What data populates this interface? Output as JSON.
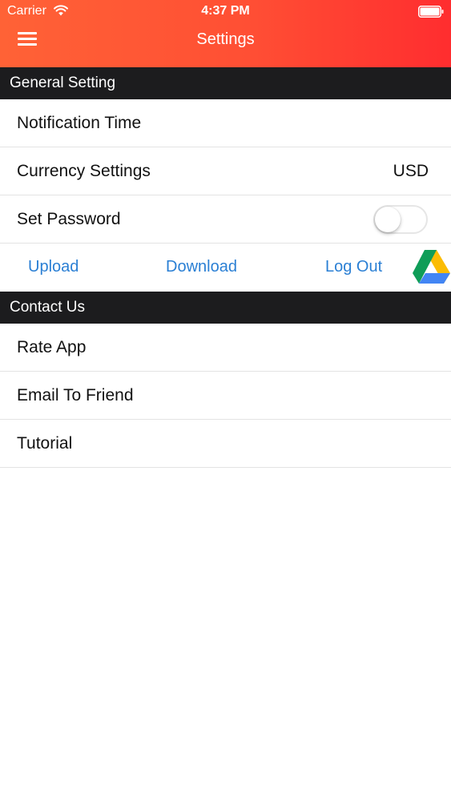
{
  "status_bar": {
    "carrier": "Carrier",
    "time": "4:37 PM",
    "wifi_icon": "wifi-icon",
    "battery_icon": "battery-full-icon"
  },
  "navbar": {
    "title": "Settings",
    "menu_icon": "hamburger-menu-icon",
    "gradient_colors": [
      "#ff6236",
      "#ff2d2f"
    ]
  },
  "general_section": {
    "header": "General Setting",
    "rows": [
      {
        "label": "Notification Time",
        "value": ""
      },
      {
        "label": "Currency Settings",
        "value": "USD"
      },
      {
        "label": "Set Password",
        "toggle_on": false
      }
    ]
  },
  "sync_actions": {
    "upload": "Upload",
    "download": "Download",
    "logout": "Log Out",
    "service_icon": "google-drive-icon",
    "link_color": "#2a7fd4"
  },
  "contact_section": {
    "header": "Contact Us",
    "rows": [
      {
        "label": "Rate App"
      },
      {
        "label": "Email To Friend"
      },
      {
        "label": "Tutorial"
      }
    ]
  },
  "colors": {
    "section_header_bg": "#1c1c1e",
    "separator": "#e3e3e3"
  }
}
